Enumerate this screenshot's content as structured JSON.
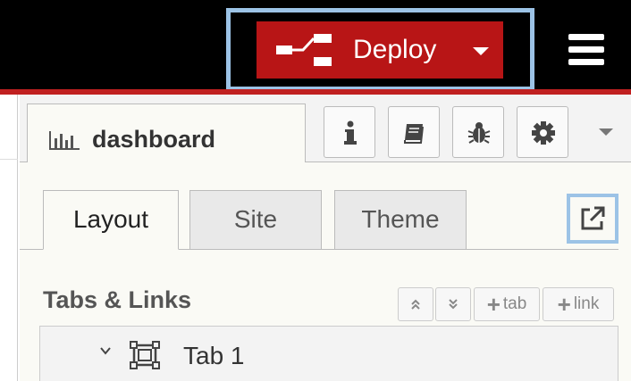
{
  "header": {
    "deploy_label": "Deploy",
    "deploy_color": "#b81516",
    "highlight_color": "#9cc3e6",
    "menu_icon": "hamburger-icon"
  },
  "sidebar": {
    "main_tab": {
      "icon": "bar-chart-icon",
      "label": "dashboard"
    },
    "tool_buttons": [
      {
        "name": "info-icon",
        "glyph": "i"
      },
      {
        "name": "book-icon"
      },
      {
        "name": "bug-icon"
      },
      {
        "name": "gear-icon"
      }
    ],
    "subtabs": [
      {
        "label": "Layout",
        "active": true
      },
      {
        "label": "Site",
        "active": false
      },
      {
        "label": "Theme",
        "active": false
      }
    ],
    "external_link_icon": "external-link-icon",
    "section_title": "Tabs & Links",
    "section_buttons": {
      "collapse_all": "collapse-up-icon",
      "expand_all": "expand-down-icon",
      "add_tab_label": "tab",
      "add_link_label": "link"
    },
    "tabs": [
      {
        "label": "Tab 1",
        "icon": "tab-frame-icon",
        "expanded": true
      }
    ]
  }
}
